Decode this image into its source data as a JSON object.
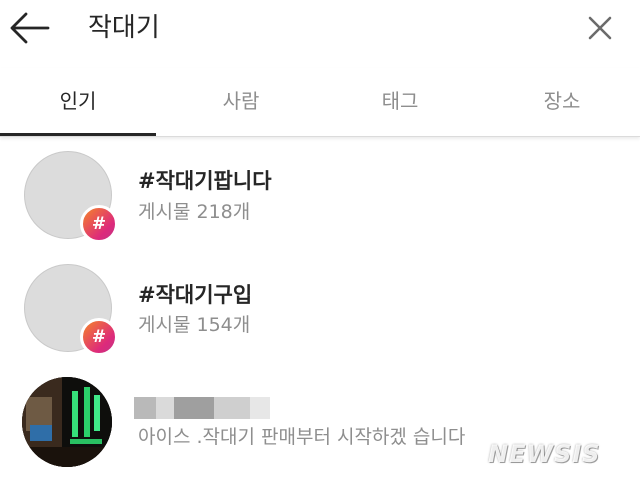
{
  "header": {
    "title": "작대기",
    "back_icon": "arrow-left-icon",
    "close_icon": "close-icon"
  },
  "tabs": [
    {
      "label": "인기",
      "active": true
    },
    {
      "label": "사람",
      "active": false
    },
    {
      "label": "태그",
      "active": false
    },
    {
      "label": "장소",
      "active": false
    }
  ],
  "results": [
    {
      "type": "hashtag",
      "title": "#작대기팝니다",
      "subtitle": "게시물 218개",
      "badge": "#"
    },
    {
      "type": "hashtag",
      "title": "#작대기구입",
      "subtitle": "게시물 154개",
      "badge": "#"
    },
    {
      "type": "account",
      "subtitle": "아이스 .작대기  판매부터 시작하겠 습니다"
    }
  ],
  "watermark": "NEWSIS",
  "colors": {
    "text": "#262626",
    "secondary": "#8e8e8e",
    "divider": "#dbdbdb",
    "badge_gradient": [
      "#f58529",
      "#dd2a7b",
      "#c13584"
    ]
  }
}
